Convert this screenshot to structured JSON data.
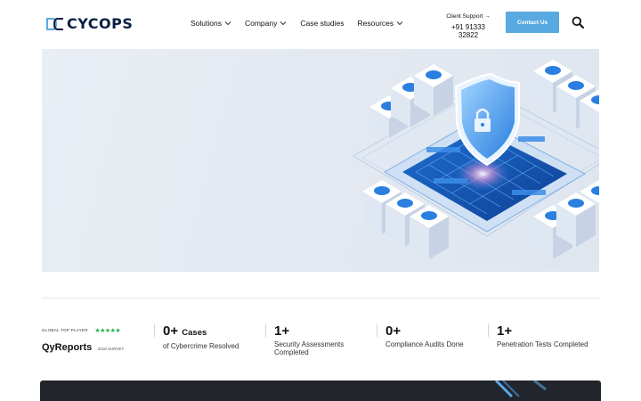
{
  "brand": {
    "name": "CYCOPS"
  },
  "nav": {
    "items": [
      {
        "label": "Solutions",
        "has_dropdown": true
      },
      {
        "label": "Company",
        "has_dropdown": true
      },
      {
        "label": "Case studies",
        "has_dropdown": false
      },
      {
        "label": "Resources",
        "has_dropdown": true
      }
    ]
  },
  "support": {
    "label": "Client Support →",
    "phone": "+91 91333 32822"
  },
  "cta": {
    "contact_label": "Contact Us"
  },
  "icons": {
    "search": "search-icon",
    "shield": "shield-lock-icon",
    "chevron": "chevron-down-icon"
  },
  "colors": {
    "accent": "#58a9df",
    "brand_dark": "#0a1f44",
    "stars": "#22b14c",
    "banner": "#22252b"
  },
  "badge": {
    "tag": "GLOBAL TOP PLAYER",
    "stars": "★★★★★",
    "name": "QyReports",
    "year": "2018 SURVEY"
  },
  "stats": [
    {
      "value": "0+",
      "unit": "Cases",
      "label": "of Cybercrime Resolved"
    },
    {
      "value": "1+",
      "unit": "",
      "label": "Security Assessments Completed"
    },
    {
      "value": "0+",
      "unit": "",
      "label": "Compliance Audits Done"
    },
    {
      "value": "1+",
      "unit": "",
      "label": "Penetration Tests Completed"
    }
  ]
}
